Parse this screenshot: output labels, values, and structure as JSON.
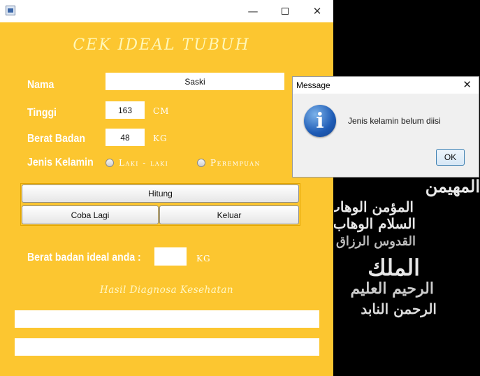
{
  "window": {
    "title": "",
    "heading": "CEK IDEAL TUBUH"
  },
  "form": {
    "nama_label": "Nama",
    "nama_value": "Saski",
    "tinggi_label": "Tinggi",
    "tinggi_value": "163",
    "tinggi_unit": "CM",
    "berat_label": "Berat Badan",
    "berat_value": "48",
    "berat_unit": "KG",
    "jenis_label": "Jenis Kelamin",
    "radio_laki": "Laki - laki",
    "radio_perempuan": "Perempuan"
  },
  "buttons": {
    "hitung": "Hitung",
    "coba_lagi": "Coba Lagi",
    "keluar": "Keluar"
  },
  "result": {
    "ideal_label": "Berat badan ideal anda :",
    "ideal_value": "",
    "ideal_unit": "KG",
    "diagnosa_label": "Hasil Diagnosa Kesehatan",
    "output1": "",
    "output2": ""
  },
  "dialog": {
    "title": "Message",
    "message": "Jenis kelamin belum diisi",
    "ok": "OK",
    "icon": "info-icon"
  },
  "background_text": {
    "line1": "المهيمن",
    "line2": "المؤمن الوهاب",
    "line3": "السلام الوهاب",
    "line4": "القدوس الرزاق",
    "line5": "الملك",
    "line6": "الرحيم العليم",
    "line7": "الرحمن النابد"
  }
}
